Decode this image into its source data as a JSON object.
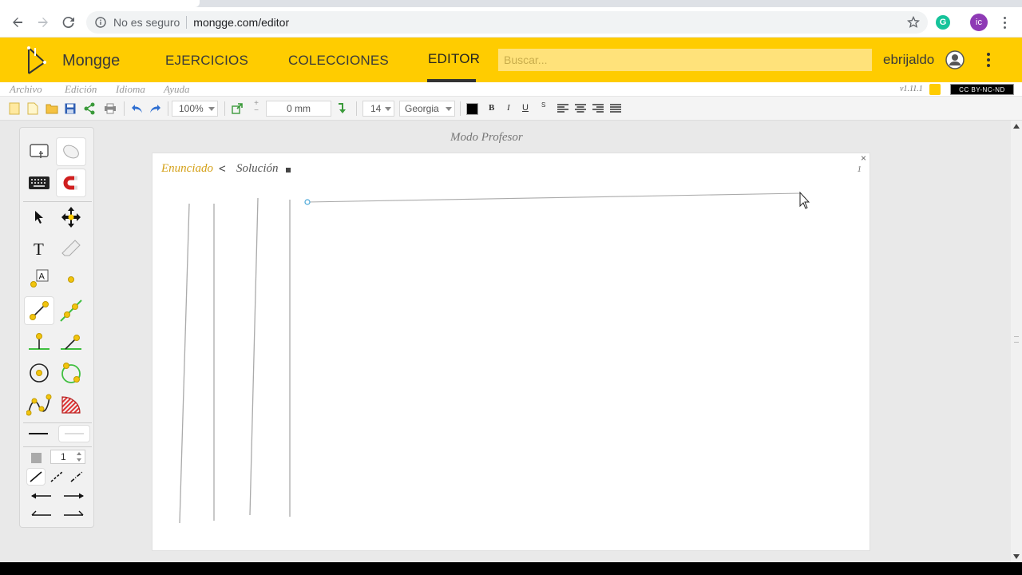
{
  "browser": {
    "security_label": "No es seguro",
    "url": "mongge.com/editor",
    "profile_initials": "ic",
    "extension_letter": "G"
  },
  "app": {
    "brand": "Mongge",
    "nav": {
      "ejercicios": "EJERCICIOS",
      "colecciones": "COLECCIONES",
      "editor": "EDITOR"
    },
    "search_placeholder": "Buscar...",
    "username": "ebrijaldo",
    "accent_color": "#ffcc00"
  },
  "menubar": {
    "archivo": "Archivo",
    "edicion": "Edición",
    "idioma": "Idioma",
    "ayuda": "Ayuda",
    "version": "v1.11.1",
    "license": "CC BY-NC-ND"
  },
  "toolbar": {
    "zoom": "100%",
    "offset": "0 mm",
    "font_size": "14",
    "font_family": "Georgia",
    "bold": "B",
    "italic": "I",
    "underline": "U",
    "strike": "S"
  },
  "palette": {
    "line_width": "1"
  },
  "editor": {
    "mode": "Modo Profesor",
    "tab_enunciado": "Enunciado",
    "tab_separator": "<",
    "tab_solucion": "Solución",
    "page_number": "1",
    "close_glyph": "×"
  }
}
